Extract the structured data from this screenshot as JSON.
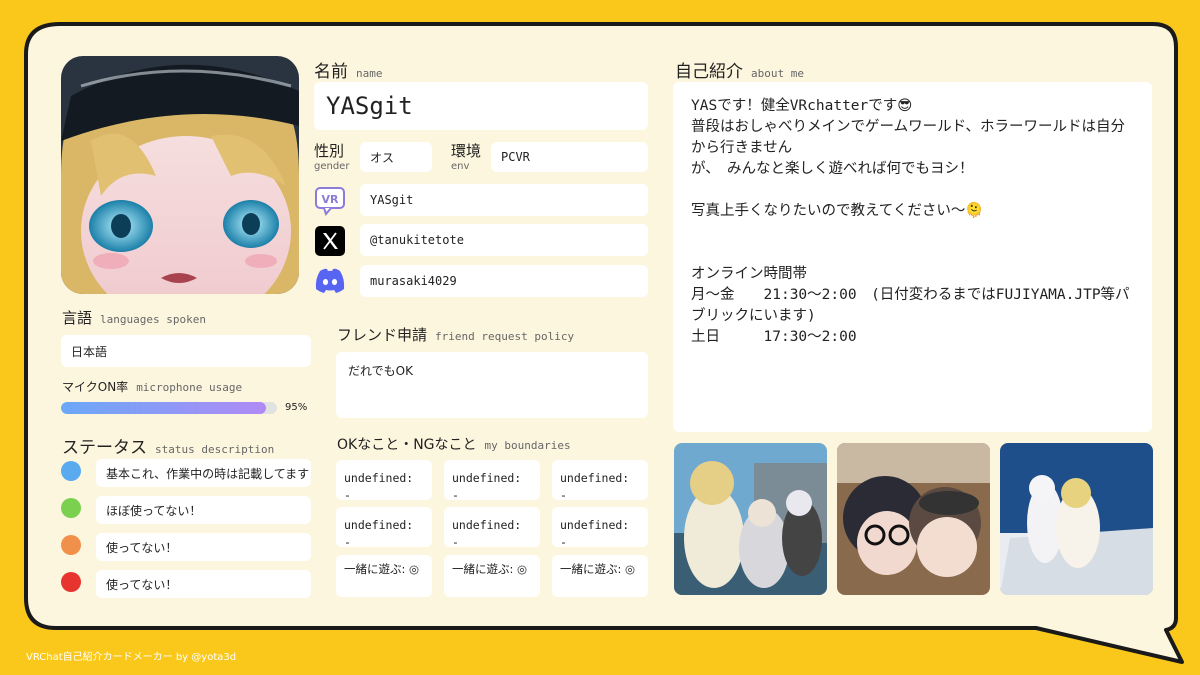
{
  "profile": {
    "name_label": "名前",
    "name_sub": "name",
    "name": "YASgit",
    "gender_label": "性別",
    "gender_sub": "gender",
    "gender": "オス",
    "env_label": "環境",
    "env_sub": "env",
    "env": "PCVR",
    "vrchat_id": "YASgit",
    "x_handle": "@tanukitetote",
    "discord": "murasaki4029"
  },
  "languages": {
    "label": "言語",
    "sub": "languages spoken",
    "value": "日本語"
  },
  "mic": {
    "label": "マイクON率",
    "sub": "microphone usage",
    "percent_text": "95%",
    "percent": 95
  },
  "friend_request": {
    "label": "フレンド申請",
    "sub": "friend request policy",
    "value": "だれでもOK"
  },
  "status": {
    "label": "ステータス",
    "sub": "status description",
    "items": [
      {
        "color": "#5aaaf0",
        "text": "基本これ、作業中の時は記載してます"
      },
      {
        "color": "#7bd14f",
        "text": "ほぼ使ってない！"
      },
      {
        "color": "#f0904a",
        "text": "使ってない！"
      },
      {
        "color": "#e8342e",
        "text": "使ってない！"
      }
    ]
  },
  "boundaries": {
    "label": "OKなこと・NGなこと",
    "sub": "my boundaries",
    "items": [
      "undefined: -",
      "undefined: -",
      "undefined: -",
      "undefined: -",
      "undefined: -",
      "undefined: -",
      "一緒に遊ぶ: ◎",
      "一緒に遊ぶ: ◎",
      "一緒に遊ぶ: ◎"
    ]
  },
  "about": {
    "label": "自己紹介",
    "sub": "about me",
    "text": "YASです！健全VRchatterです😎\n普段はおしゃべりメインでゲームワールド、ホラーワールドは自分から行きません\nが、　みんなと楽しく遊べれば何でもヨシ！\n\n写真上手くなりたいので教えてください〜🫠\n\n\nオンライン時間帯\n月〜金　　21:30〜2:00　(日付変わるまではFUJIYAMA.JTP等パブリックにいます)\n土日　　　17:30〜2:00"
  },
  "icons": {
    "vrchat": "vrchat-logo-icon",
    "x": "x-logo-icon",
    "discord": "discord-logo-icon"
  },
  "colors": {
    "frame": "#f9c81a",
    "card": "#fdf6df",
    "mic_bar_start": "#6aa8f7",
    "mic_bar_end": "#b08af5"
  },
  "footer": "VRChat自己紹介カードメーカー by @yota3d"
}
